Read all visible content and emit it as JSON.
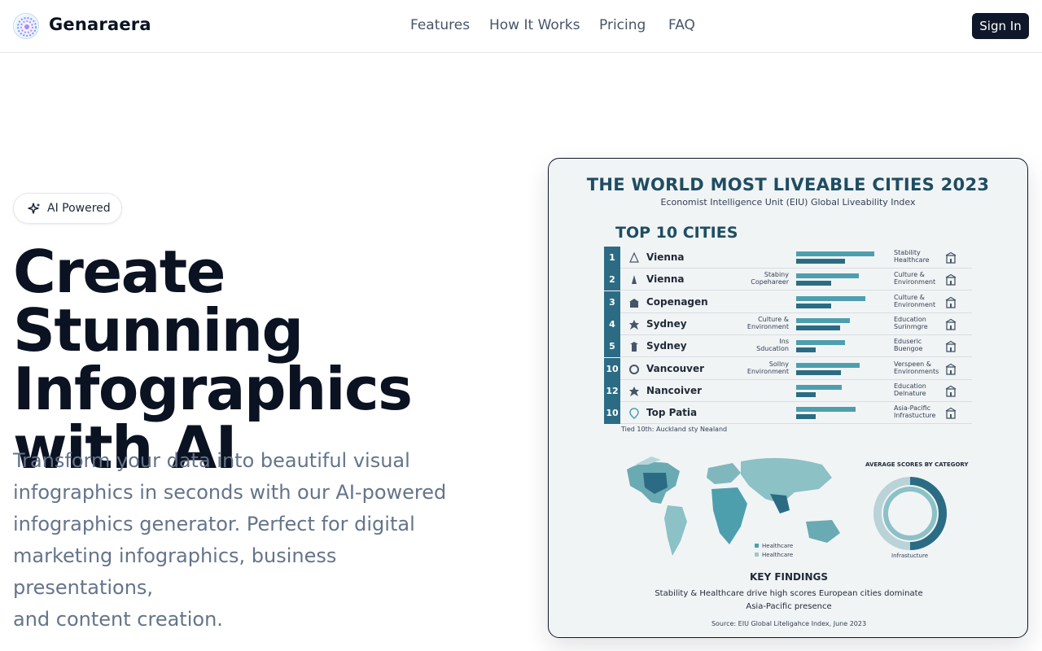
{
  "header": {
    "brand": "Genaraera",
    "nav": [
      "Features",
      "How It Works",
      "Pricing",
      "FAQ"
    ],
    "sign_in": "Sign In"
  },
  "hero": {
    "badge": "AI Powered",
    "title_lines": [
      "Create Stunning",
      "Infographics",
      "with AI"
    ],
    "description_lines": [
      "Transform your data into beautiful visual",
      "infographics in seconds with our AI-powered",
      "infographics generator. Perfect for digital",
      "marketing infographics, business presentations,",
      "and content creation."
    ]
  },
  "infographic": {
    "title": "THE WORLD MOST LIVEABLE CITIES 2023",
    "subtitle": "Economist Intelligence Unit (EIU) Global Liveability Index",
    "section": "TOP 10 CITIES",
    "rows": [
      {
        "rank": "1",
        "city": "Vienna",
        "mid": "",
        "right": "Stability\nHealthcare",
        "bar1": 0.8,
        "bar2": 0.5
      },
      {
        "rank": "2",
        "city": "Vienna",
        "mid": "Stabiny\nCopehareer",
        "right": "Culture &\nEnvironment",
        "bar1": 0.64,
        "bar2": 0.36
      },
      {
        "rank": "3",
        "city": "Copenagen",
        "mid": "",
        "right": "Culture &\nEnvironment",
        "bar1": 0.71,
        "bar2": 0.36
      },
      {
        "rank": "4",
        "city": "Sydney",
        "mid": "Culture &\nEnvironment",
        "right": "Education\nSurinmgre",
        "bar1": 0.55,
        "bar2": 0.45
      },
      {
        "rank": "5",
        "city": "Sydney",
        "mid": "Ins\nSducation",
        "right": "Eduseric\nBuengoe",
        "bar1": 0.5,
        "bar2": 0.2
      },
      {
        "rank": "10",
        "city": "Vancouver",
        "mid": "Sollny\nEnvironment",
        "right": "Verspeen &\nEnvironments",
        "bar1": 0.65,
        "bar2": 0.46
      },
      {
        "rank": "12",
        "city": "Nancoiver",
        "mid": "",
        "right": "Education\nDelnature",
        "bar1": 0.47,
        "bar2": 0.2
      },
      {
        "rank": "10",
        "city": "Top Patia",
        "mid": "",
        "right": "Asia-Pacific\nInfrastucture",
        "bar1": 0.61,
        "bar2": 0.2
      }
    ],
    "tied": "Tied 10th: Auckland sty Nealand",
    "avg_title": "AVERAGE SCORES BY CATEGORY",
    "legend": [
      "Healthcare",
      "Healthcare"
    ],
    "donut_label": "Infrastucture",
    "key_findings_title": "KEY FINDINGS",
    "key_findings_lines": [
      "Stability & Healthcare drive high scores  European cities dominate",
      "Asia-Pacific presence"
    ],
    "source": "Source: EIU Global Liteligahce Index, June 2023"
  }
}
